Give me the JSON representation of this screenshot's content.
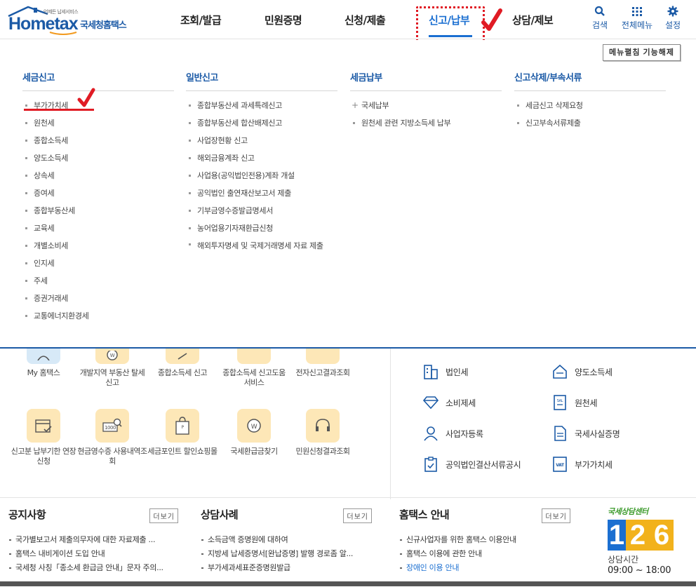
{
  "header": {
    "logo": {
      "tagline": "언제든 납세서비스",
      "home": "Home",
      "tax": "tax",
      "agency": "국세청홈택스"
    },
    "gnb": [
      {
        "label": "조회/발급"
      },
      {
        "label": "민원증명"
      },
      {
        "label": "신청/제출"
      },
      {
        "label": "신고/납부"
      },
      {
        "label": "상담/제보"
      }
    ],
    "util": [
      {
        "label": "검색",
        "icon": "search-icon"
      },
      {
        "label": "전체메뉴",
        "icon": "grid-icon"
      },
      {
        "label": "설정",
        "icon": "gear-icon"
      }
    ]
  },
  "mega": {
    "collapse_button": "메뉴펼침 기능해제",
    "columns": [
      {
        "title": "세금신고",
        "items": [
          "부가가치세",
          "원천세",
          "종합소득세",
          "양도소득세",
          "상속세",
          "증여세",
          "종합부동산세",
          "교육세",
          "개별소비세",
          "인지세",
          "주세",
          "증권거래세",
          "교통에너지환경세"
        ]
      },
      {
        "title": "일반신고",
        "items": [
          "종합부동산세 과세특례신고",
          "종합부동산세 합산배제신고",
          "사업장현황 신고",
          "해외금융계좌 신고",
          "사업용(공익법인전용)계좌 개설",
          "공익법인 출연재산보고서 제출",
          "기부금영수증발급명세서",
          "농어업용기자재환급신청",
          "해외투자명세 및 국제거래명세 자료 제출"
        ]
      },
      {
        "title": "세금납부",
        "items": [
          "국세납부",
          "원천세 관련 지방소득세 납부"
        ]
      },
      {
        "title": "신고삭제/부속서류",
        "items": [
          "세금신고 삭제요청",
          "신고부속서류제출"
        ]
      }
    ]
  },
  "services": [
    {
      "label": "My 홈택스"
    },
    {
      "label": "개발지역 부동산 탈세신고"
    },
    {
      "label": "종합소득세 신고"
    },
    {
      "label": "종합소득세 신고도움 서비스"
    },
    {
      "label": "전자신고결과조회"
    },
    {
      "label": "신고분 납부기한 연장 신청"
    },
    {
      "label": "현금영수증 사용내역조회"
    },
    {
      "label": "세금포인트 할인쇼핑몰"
    },
    {
      "label": "국세환급금찾기"
    },
    {
      "label": "민원신청결과조회"
    }
  ],
  "tax_shortcuts": [
    {
      "label": "법인세",
      "icon": "building-icon"
    },
    {
      "label": "양도소득세",
      "icon": "house-icon"
    },
    {
      "label": "소비제세",
      "icon": "diamond-icon"
    },
    {
      "label": "원천세",
      "icon": "salary-icon"
    },
    {
      "label": "사업자등록",
      "icon": "person-icon"
    },
    {
      "label": "국세사실증명",
      "icon": "document-icon"
    },
    {
      "label": "공익법인결산서류공시",
      "icon": "clipboard-icon"
    },
    {
      "label": "부가가치세",
      "icon": "vat-icon"
    }
  ],
  "boards": [
    {
      "title": "공지사항",
      "more": "더보기",
      "items": [
        "국가별보고서 제출의무자에 대한 자료제출 ...",
        "홈택스 내비게이션 도입 안내",
        "국세청 사칭「종소세 환급금 안내」문자 주의..."
      ]
    },
    {
      "title": "상담사례",
      "more": "더보기",
      "items": [
        "소득금액 증명원에 대하여",
        "지방세 납세증명서[완납증명] 발행 경로좀 알...",
        "부가세과세표준증명원발급"
      ]
    },
    {
      "title": "홈택스 안내",
      "more": "더보기",
      "items": [
        "신규사업자를 위한 홈택스 이용안내",
        "홈택스 이용에 관한 안내",
        "장애인 이용 안내"
      ]
    }
  ],
  "center": {
    "title": "국세상담센터",
    "number_1": "1",
    "number_2": "2",
    "number_3": "6",
    "hours_label": "상담시간",
    "hours": "09:00 ~ 18:00"
  },
  "colors": {
    "brand_blue": "#1b5aa6",
    "active_blue": "#1b6fd1",
    "annotation_red": "#e01b24",
    "tile_yellow": "#fde7b7"
  }
}
